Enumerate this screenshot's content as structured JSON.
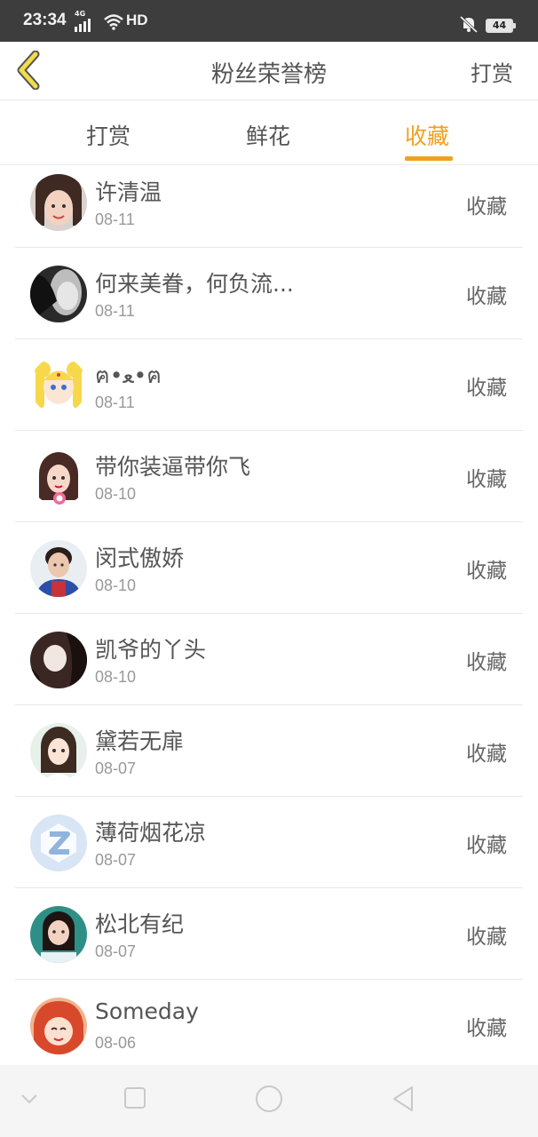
{
  "status_bar": {
    "time": "23:34",
    "network": "4G",
    "wifi_label": "HD",
    "battery": "44"
  },
  "nav": {
    "back_icon": "chevron-left-icon",
    "title": "粉丝荣誉榜",
    "right_action": "打赏"
  },
  "tabs": [
    {
      "label": "打赏",
      "active": false
    },
    {
      "label": "鲜花",
      "active": false
    },
    {
      "label": "收藏",
      "active": true
    }
  ],
  "accent_color": "#f0a020",
  "fans": [
    {
      "name": "许清温",
      "date": "08-11",
      "action": "收藏"
    },
    {
      "name": "何来美眷，何负流...",
      "date": "08-11",
      "action": "收藏"
    },
    {
      "name": "ฅ•ﻌ•ฅ",
      "date": "08-11",
      "action": "收藏"
    },
    {
      "name": "带你装逼带你飞",
      "date": "08-10",
      "action": "收藏"
    },
    {
      "name": "闵式傲娇",
      "date": "08-10",
      "action": "收藏"
    },
    {
      "name": "凯爷的丫头",
      "date": "08-10",
      "action": "收藏"
    },
    {
      "name": "黛若无扉",
      "date": "08-07",
      "action": "收藏"
    },
    {
      "name": "薄荷烟花凉",
      "date": "08-07",
      "action": "收藏"
    },
    {
      "name": "松北有纪",
      "date": "08-07",
      "action": "收藏"
    },
    {
      "name": "Someday",
      "date": "08-06",
      "action": "收藏"
    }
  ],
  "system_nav": [
    "chevron-down-icon",
    "square-icon",
    "circle-icon",
    "triangle-back-icon"
  ]
}
